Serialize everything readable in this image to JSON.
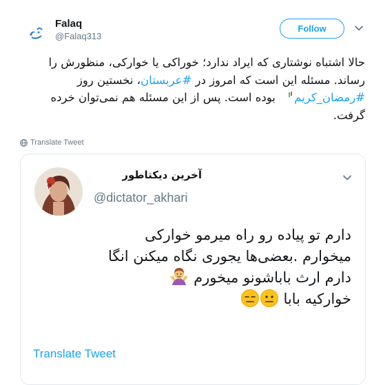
{
  "tweet": {
    "author": {
      "display_name": "Falaq",
      "handle": "@Falaq313",
      "avatar_text": "فلق"
    },
    "follow_label": "Follow",
    "text_parts": [
      "حالا اشتباه نوشتاری که ایراد ندارد؛ خوراکی یا خوارکی، منظورش را رساند. مسئله این است که امروز در ",
      "#عربستان",
      "، نخستین روز ",
      "#رمضان_کریم",
      " بوده است. پس از این مسئله هم نمی‌توان خرده گرفت."
    ],
    "translate_label": "Translate Tweet"
  },
  "quoted": {
    "display_name": "آخرین دیکتاطور",
    "handle": "@dictator_akhari",
    "lines": [
      "دارم تو پیاده رو راه میرمو خوارکی",
      "میخوارم .بعضی‌ها یجوری نگاه میکنن انگا",
      "دارم ارث باباشونو میخورم",
      "خوارکیه بابا"
    ],
    "translate_label": "Translate Tweet"
  },
  "icons": {
    "caret": "chevron-down-icon",
    "globe": "globe-icon",
    "moon": "crescent-moon-emoji",
    "shrug": "woman-shrugging-emoji",
    "neutral": "neutral-face-emoji",
    "expressionless": "expressionless-face-emoji"
  },
  "colors": {
    "accent": "#1da1f2",
    "text": "#14171a",
    "muted": "#657786",
    "border": "#e1e8ed"
  }
}
